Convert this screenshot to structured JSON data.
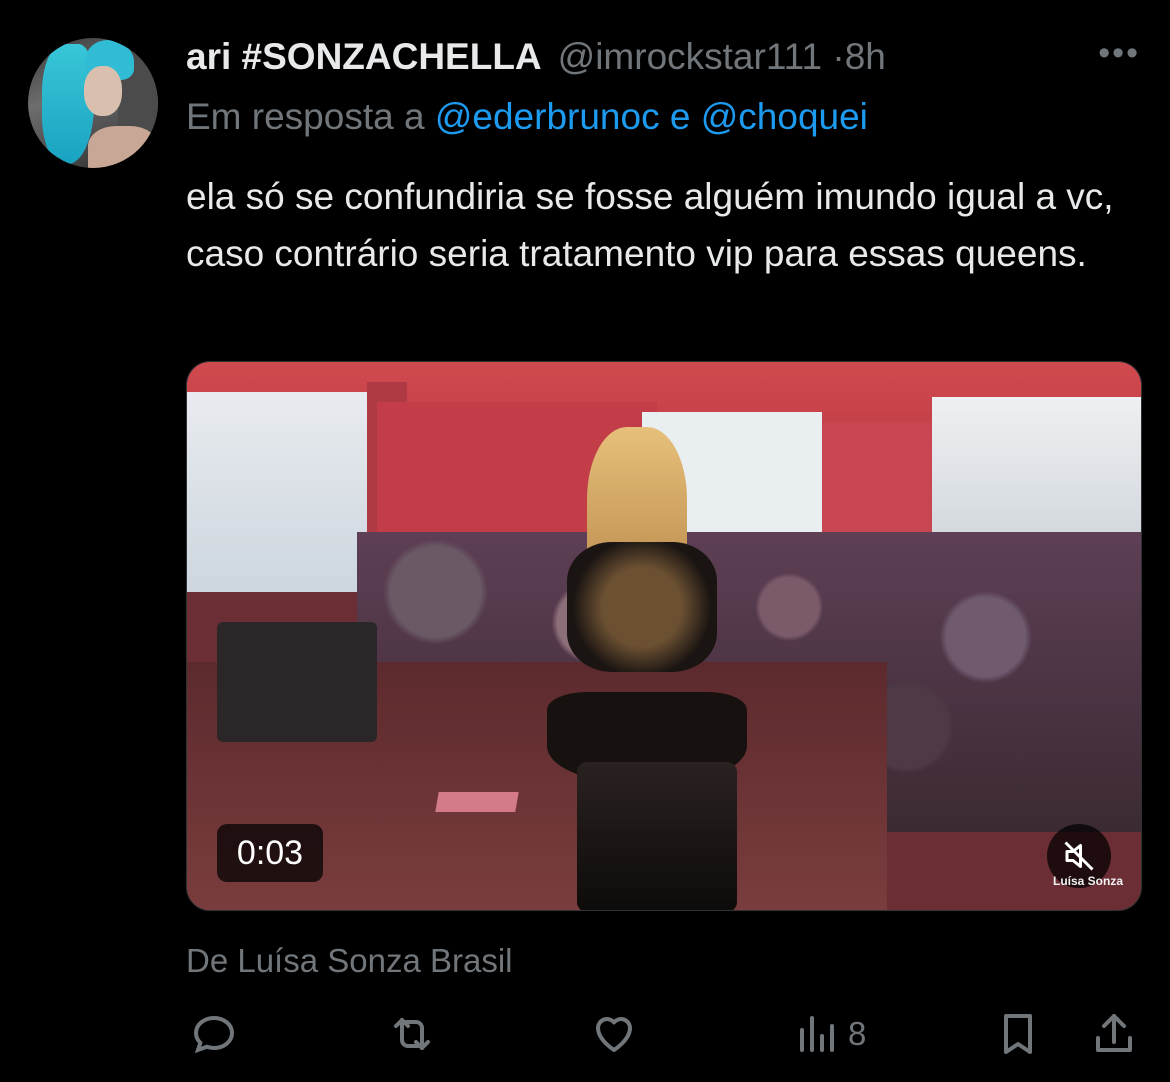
{
  "tweet": {
    "author_name": "ari #SONZACHELLA",
    "author_handle": "@imrockstar111",
    "separator": "·",
    "time": "8h",
    "more_icon": "more-horizontal-icon",
    "reply_prefix": "Em resposta a",
    "reply_user_1": "@ederbrunoc",
    "reply_conjunction": "e",
    "reply_user_2": "@choquei",
    "text": "ela só se confundiria se fosse alguém imundo igual a vc, caso contrário seria tratamento vip para essas queens.",
    "media": {
      "duration": "0:03",
      "watermark": "Luísa Sonza",
      "mute_icon": "muted-speaker-icon"
    },
    "source": "De Luísa Sonza Brasil",
    "actions": {
      "reply_icon": "reply-icon",
      "retweet_icon": "retweet-icon",
      "like_icon": "heart-icon",
      "views_icon": "views-chart-icon",
      "views_count": "8",
      "bookmark_icon": "bookmark-icon",
      "share_icon": "share-icon"
    },
    "colors": {
      "background": "#000000",
      "text": "#e7e9ea",
      "secondary": "#71767b",
      "link": "#1d9bf0"
    }
  }
}
